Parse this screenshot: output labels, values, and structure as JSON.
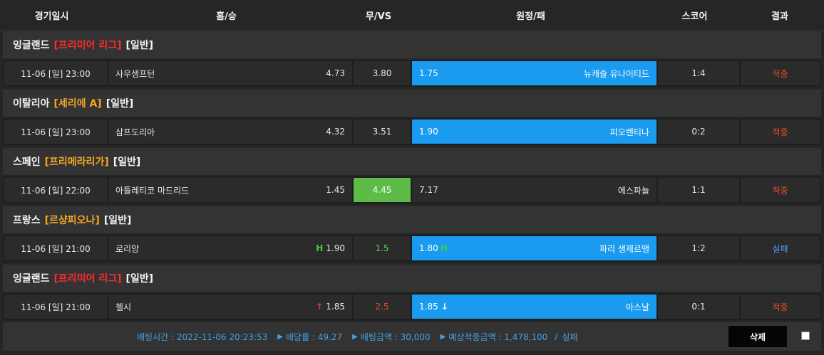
{
  "header": {
    "date": "경기일시",
    "home": "홈/승",
    "draw": "무/VS",
    "away": "원정/패",
    "score": "스코어",
    "result": "결과"
  },
  "colors": {
    "selected_blue": "#1a9bf0",
    "selected_green": "#5dbb47",
    "hit_red": "#e84a2e",
    "miss_blue": "#4aa3ff",
    "league_red": "#ff2b2b",
    "league_orange": "#f5a623"
  },
  "matches": [
    {
      "league": {
        "country": "잉글랜드",
        "name": "[프리미어 리그]",
        "type": "[일반]"
      },
      "date": "11-06 [일] 23:00",
      "home_team": "사우샘프턴",
      "home_odds": "4.73",
      "draw_odds": "3.80",
      "away_odds": "1.75",
      "away_team": "뉴캐슬 유나이티드",
      "score": "1:4",
      "result": "적중"
    },
    {
      "league": {
        "country": "이탈리아",
        "name": "[세리에 A]",
        "type": "[일반]"
      },
      "date": "11-06 [일] 23:00",
      "home_team": "삼프도리아",
      "home_odds": "4.32",
      "draw_odds": "3.51",
      "away_odds": "1.90",
      "away_team": "피오렌티나",
      "score": "0:2",
      "result": "적중"
    },
    {
      "league": {
        "country": "스페인",
        "name": "[프리메라리가]",
        "type": "[일반]"
      },
      "date": "11-06 [일] 22:00",
      "home_team": "아틀레티코 마드리드",
      "home_odds": "1.45",
      "draw_odds": "4.45",
      "away_odds": "7.17",
      "away_team": "에스파뇰",
      "score": "1:1",
      "result": "적중"
    },
    {
      "league": {
        "country": "프랑스",
        "name": "[르샹피오나]",
        "type": "[일반]"
      },
      "date": "11-06 [일] 21:00",
      "home_team": "로리앙",
      "home_odds": "1.90",
      "home_indicator": "H",
      "draw_odds": "1.5",
      "away_odds": "1.80",
      "away_indicator": "H",
      "away_team": "파리 생제르맹",
      "score": "1:2",
      "result": "실패"
    },
    {
      "league": {
        "country": "잉글랜드",
        "name": "[프리미어 리그]",
        "type": "[일반]"
      },
      "date": "11-06 [일] 21:00",
      "home_team": "첼시",
      "home_odds": "1.85",
      "home_indicator": "↑",
      "draw_odds": "2.5",
      "away_odds": "1.85",
      "away_indicator": "↓",
      "away_team": "아스날",
      "score": "0:1",
      "result": "적중"
    }
  ],
  "footer": {
    "bet_time": "배팅시간 : 2022-11-06 20:23:53",
    "bet_rate": "배당률 : 49.27",
    "bet_amount": "배팅금액 : 30,000",
    "expected": "예상적중금액 : 1,478,100",
    "sep": "/",
    "status": "실패",
    "arrow": "▶",
    "delete_label": "삭제"
  }
}
